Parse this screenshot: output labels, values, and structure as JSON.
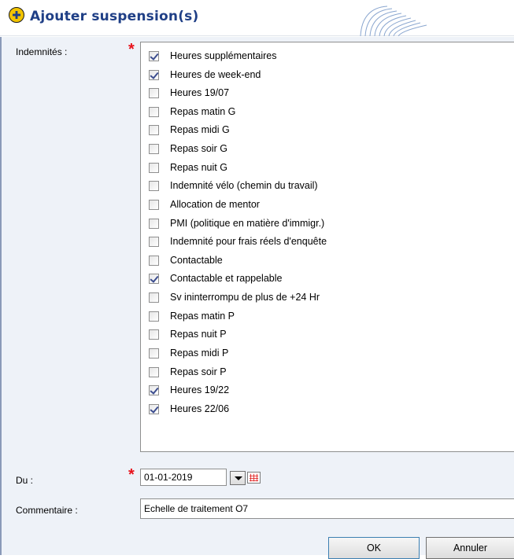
{
  "window": {
    "title": "Ajouter suspension(s)"
  },
  "form": {
    "indemnites_label": "Indemnités :",
    "required_mark": "*",
    "du_label": "Du :",
    "commentaire_label": "Commentaire :"
  },
  "indemnites": [
    {
      "label": "Heures supplémentaires",
      "checked": true
    },
    {
      "label": "Heures de week-end",
      "checked": true
    },
    {
      "label": "Heures 19/07",
      "checked": false
    },
    {
      "label": "Repas matin G",
      "checked": false
    },
    {
      "label": "Repas midi G",
      "checked": false
    },
    {
      "label": "Repas soir G",
      "checked": false
    },
    {
      "label": "Repas nuit G",
      "checked": false
    },
    {
      "label": "Indemnité vélo (chemin du travail)",
      "checked": false
    },
    {
      "label": "Allocation de mentor",
      "checked": false
    },
    {
      "label": "PMI (politique en matière d'immigr.)",
      "checked": false
    },
    {
      "label": "Indemnité pour frais réels d'enquête",
      "checked": false
    },
    {
      "label": "Contactable",
      "checked": false
    },
    {
      "label": "Contactable et rappelable",
      "checked": true
    },
    {
      "label": "Sv ininterrompu de plus de +24 Hr",
      "checked": false
    },
    {
      "label": "Repas matin P",
      "checked": false
    },
    {
      "label": "Repas nuit P",
      "checked": false
    },
    {
      "label": "Repas midi P",
      "checked": false
    },
    {
      "label": "Repas soir P",
      "checked": false
    },
    {
      "label": "Heures 19/22",
      "checked": true
    },
    {
      "label": "Heures 22/06",
      "checked": true
    }
  ],
  "du": {
    "value": "01-01-2019"
  },
  "commentaire": {
    "value": "Echelle de traitement O7"
  },
  "buttons": {
    "ok": "OK",
    "cancel": "Annuler"
  },
  "colors": {
    "title": "#1f3f86",
    "required": "#e8121b",
    "panel_bg": "#eef2f8"
  },
  "icons": {
    "app": "app-logo-icon",
    "dropdown": "chevron-down-icon",
    "calendar": "calendar-icon"
  }
}
